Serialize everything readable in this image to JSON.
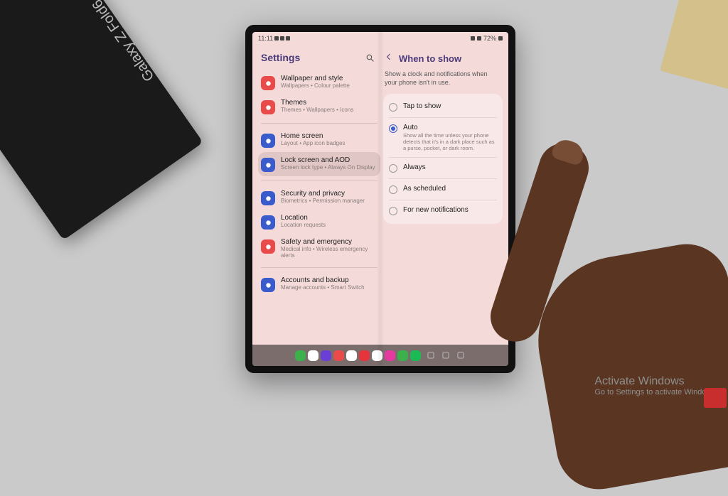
{
  "statusbar": {
    "time": "11:11",
    "battery": "72%"
  },
  "left": {
    "title": "Settings",
    "items": [
      {
        "icon_color": "#e94b4b",
        "title": "Wallpaper and style",
        "sub": "Wallpapers  •  Colour palette"
      },
      {
        "icon_color": "#e94b4b",
        "title": "Themes",
        "sub": "Themes  •  Wallpapers  •  Icons"
      },
      {
        "icon_color": "#3a5bcc",
        "title": "Home screen",
        "sub": "Layout  •  App icon badges"
      },
      {
        "icon_color": "#3a5bcc",
        "title": "Lock screen and AOD",
        "sub": "Screen lock type  •  Always On Display",
        "selected": true
      },
      {
        "icon_color": "#3a5bcc",
        "title": "Security and privacy",
        "sub": "Biometrics  •  Permission manager"
      },
      {
        "icon_color": "#3a5bcc",
        "title": "Location",
        "sub": "Location requests"
      },
      {
        "icon_color": "#e94b4b",
        "title": "Safety and emergency",
        "sub": "Medical info  •  Wireless emergency alerts"
      },
      {
        "icon_color": "#3a5bcc",
        "title": "Accounts and backup",
        "sub": "Manage accounts  •  Smart Switch"
      }
    ],
    "dividers_after": [
      1,
      3,
      6
    ]
  },
  "right": {
    "title": "When to show",
    "desc": "Show a clock and notifications when your phone isn't in use.",
    "options": [
      {
        "title": "Tap to show",
        "sub": "",
        "selected": false
      },
      {
        "title": "Auto",
        "sub": "Show all the time unless your phone detects that it's in a dark place such as a purse, pocket, or dark room.",
        "selected": true
      },
      {
        "title": "Always",
        "sub": "",
        "selected": false
      },
      {
        "title": "As scheduled",
        "sub": "",
        "selected": false
      },
      {
        "title": "For new notifications",
        "sub": "",
        "selected": false
      }
    ]
  },
  "dock_colors": [
    "#3cb04a",
    "#ffffff",
    "#6a40d4",
    "#e94b4b",
    "#ffffff",
    "#e6343c",
    "#ffffff",
    "#e43aa0",
    "#3cb04a",
    "#1db954"
  ],
  "watermark": {
    "title": "Activate Windows",
    "sub": "Go to Settings to activate Windows."
  }
}
